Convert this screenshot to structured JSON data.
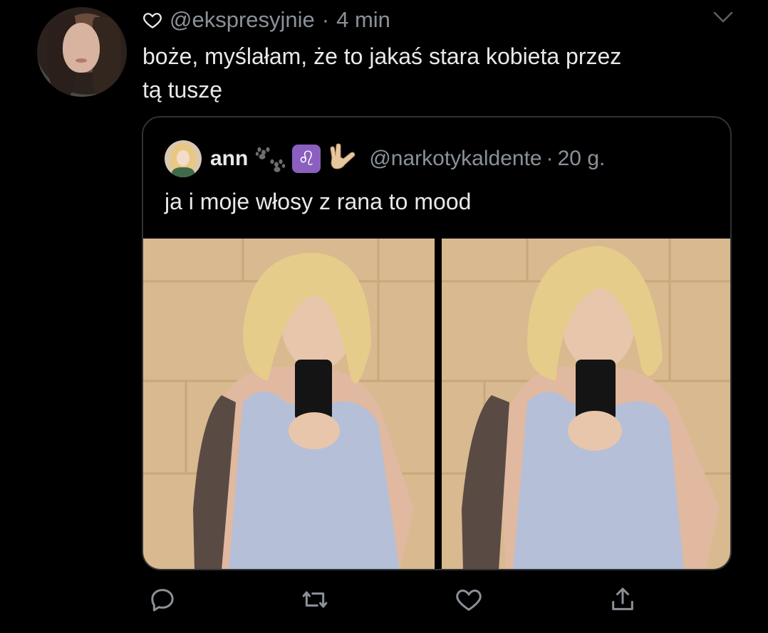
{
  "tweet": {
    "handle": "@ekspresyjnie",
    "separator": "·",
    "time": "4 min",
    "text_line1": "boże, myślałam, że to jakaś stara kobieta przez",
    "text_line2": "tą tuszę"
  },
  "quoted": {
    "name": "ann",
    "emoji_paw": "🐾",
    "emoji_zodiac": "♌",
    "emoji_hand": "🤟",
    "handle": "@narkotykaldente",
    "separator": "·",
    "time": "20 g.",
    "text": "ja i moje włosy z rana to mood"
  },
  "icons": {
    "like_small": "heart-outline-icon",
    "menu": "chevron-down-icon",
    "reply": "reply-icon",
    "retweet": "retweet-icon",
    "like": "heart-icon",
    "share": "share-icon"
  },
  "colors": {
    "background": "#000000",
    "text_primary": "#e7e9ea",
    "text_secondary": "#8b9199",
    "border": "#2f3336"
  }
}
